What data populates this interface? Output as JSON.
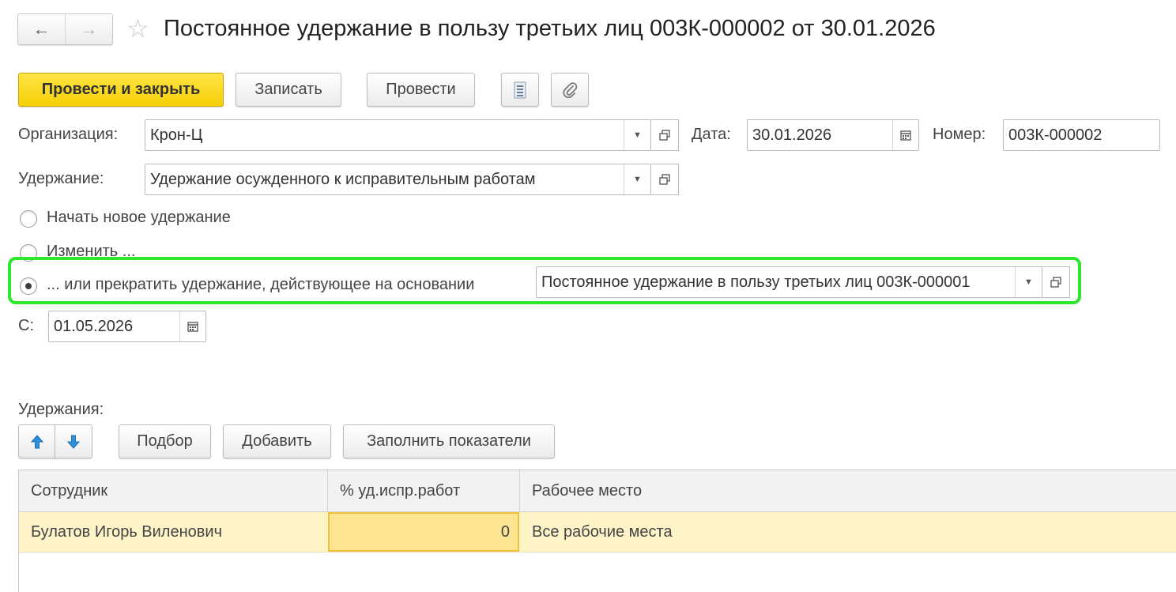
{
  "header": {
    "title": "Постоянное удержание в пользу третьих лиц 003К-000002 от 30.01.2026"
  },
  "toolbar": {
    "post_close_label": "Провести и закрыть",
    "save_label": "Записать",
    "post_label": "Провести"
  },
  "form": {
    "org_label": "Организация:",
    "org_value": "Крон-Ц",
    "date_label": "Дата:",
    "date_value": "30.01.2026",
    "number_label": "Номер:",
    "number_value": "003К-000002",
    "deduction_label": "Удержание:",
    "deduction_value": "Удержание осужденного к исправительным работам",
    "radio_new": "Начать новое удержание",
    "radio_change": "Изменить ...",
    "radio_stop": "... или прекратить удержание, действующее на основании",
    "basis_value": "Постоянное удержание в пользу третьих лиц 003К-000001",
    "from_label": "С:",
    "from_value": "01.05.2026",
    "selected_option": "radio_stop"
  },
  "deductions": {
    "section_label": "Удержания:",
    "pick_label": "Подбор",
    "add_label": "Добавить",
    "fill_label": "Заполнить показатели",
    "columns": [
      "Сотрудник",
      "% уд.испр.работ",
      "Рабочее место"
    ],
    "rows": [
      {
        "employee": "Булатов Игорь Виленович",
        "percent": "0",
        "workplace": "Все рабочие места"
      }
    ]
  },
  "colors": {
    "primary_button": "#f5cf06",
    "highlight_frame": "#2ee62e",
    "selected_row": "#fff4c8",
    "active_cell": "#fde592",
    "arrow_blue": "#2f8fd8"
  }
}
